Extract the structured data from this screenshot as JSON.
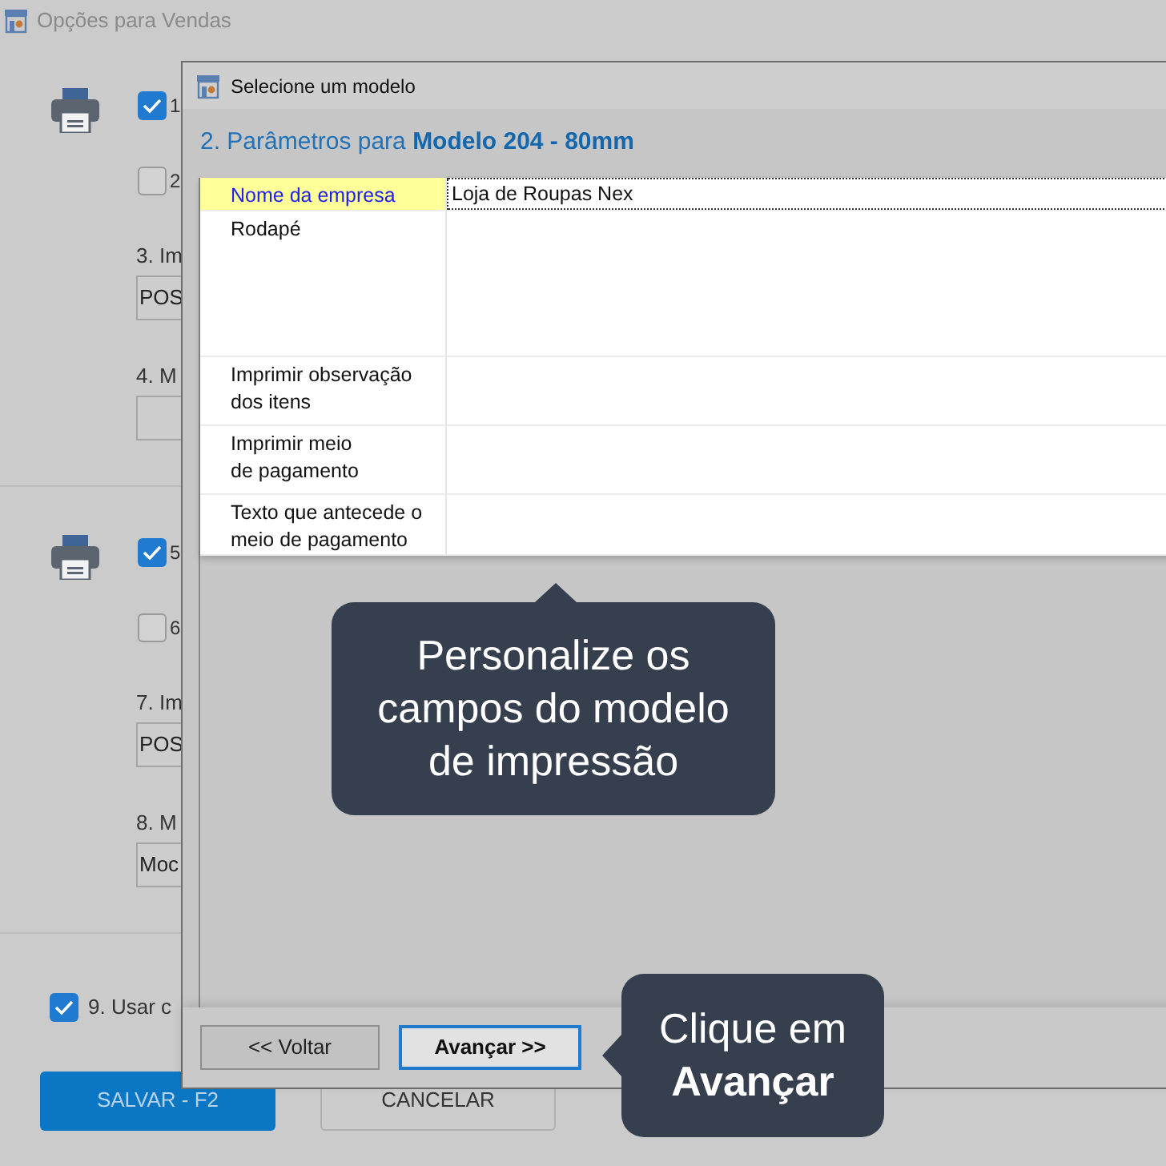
{
  "window": {
    "title": "Opções para Vendas"
  },
  "sections": [
    {
      "options": [
        {
          "label": "1",
          "checked": true
        },
        {
          "label": "2",
          "checked": false
        }
      ],
      "fields": [
        {
          "label": "3. Im",
          "value": "POS"
        },
        {
          "label": "4. M"
        }
      ]
    },
    {
      "options": [
        {
          "label": "5",
          "checked": true
        },
        {
          "label": "6",
          "checked": false
        }
      ],
      "fields": [
        {
          "label": "7. Im",
          "value": "POS"
        },
        {
          "label": "8. M",
          "value": "Moc"
        }
      ]
    }
  ],
  "extra_option": {
    "label": "9. Usar c",
    "checked": true
  },
  "buttons": [
    {
      "label": "SALVAR - F2",
      "kind": "primary"
    },
    {
      "label": "CANCELAR",
      "kind": "secondary"
    }
  ],
  "dialog": {
    "title": "Selecione um modelo",
    "heading": "2. Parâmetros para **Modelo 204 - 80mm**",
    "parameters": [
      {
        "name": "Nome da empresa",
        "value": "Loja de Roupas Nex",
        "selected": true,
        "kind": "text"
      },
      {
        "name": "Rodapé",
        "selected": false,
        "kind": "multiline"
      },
      {
        "name": "Imprimir observação dos itens",
        "selected": false,
        "kind": "option"
      },
      {
        "name": "Imprimir meio\nde pagamento",
        "selected": false,
        "kind": "option"
      },
      {
        "name": "Texto que antecede o meio de pagamento",
        "selected": false,
        "kind": "text"
      }
    ],
    "buttons": [
      {
        "label": "<< Voltar",
        "focused": false
      },
      {
        "label": "Avançar >>",
        "focused": true
      }
    ]
  },
  "tooltips": [
    {
      "text": "Personalize os\ncampos do modelo\nde impressão",
      "kind": "above"
    },
    {
      "text": "Clique em\n**Avançar**",
      "kind": "beside"
    }
  ]
}
